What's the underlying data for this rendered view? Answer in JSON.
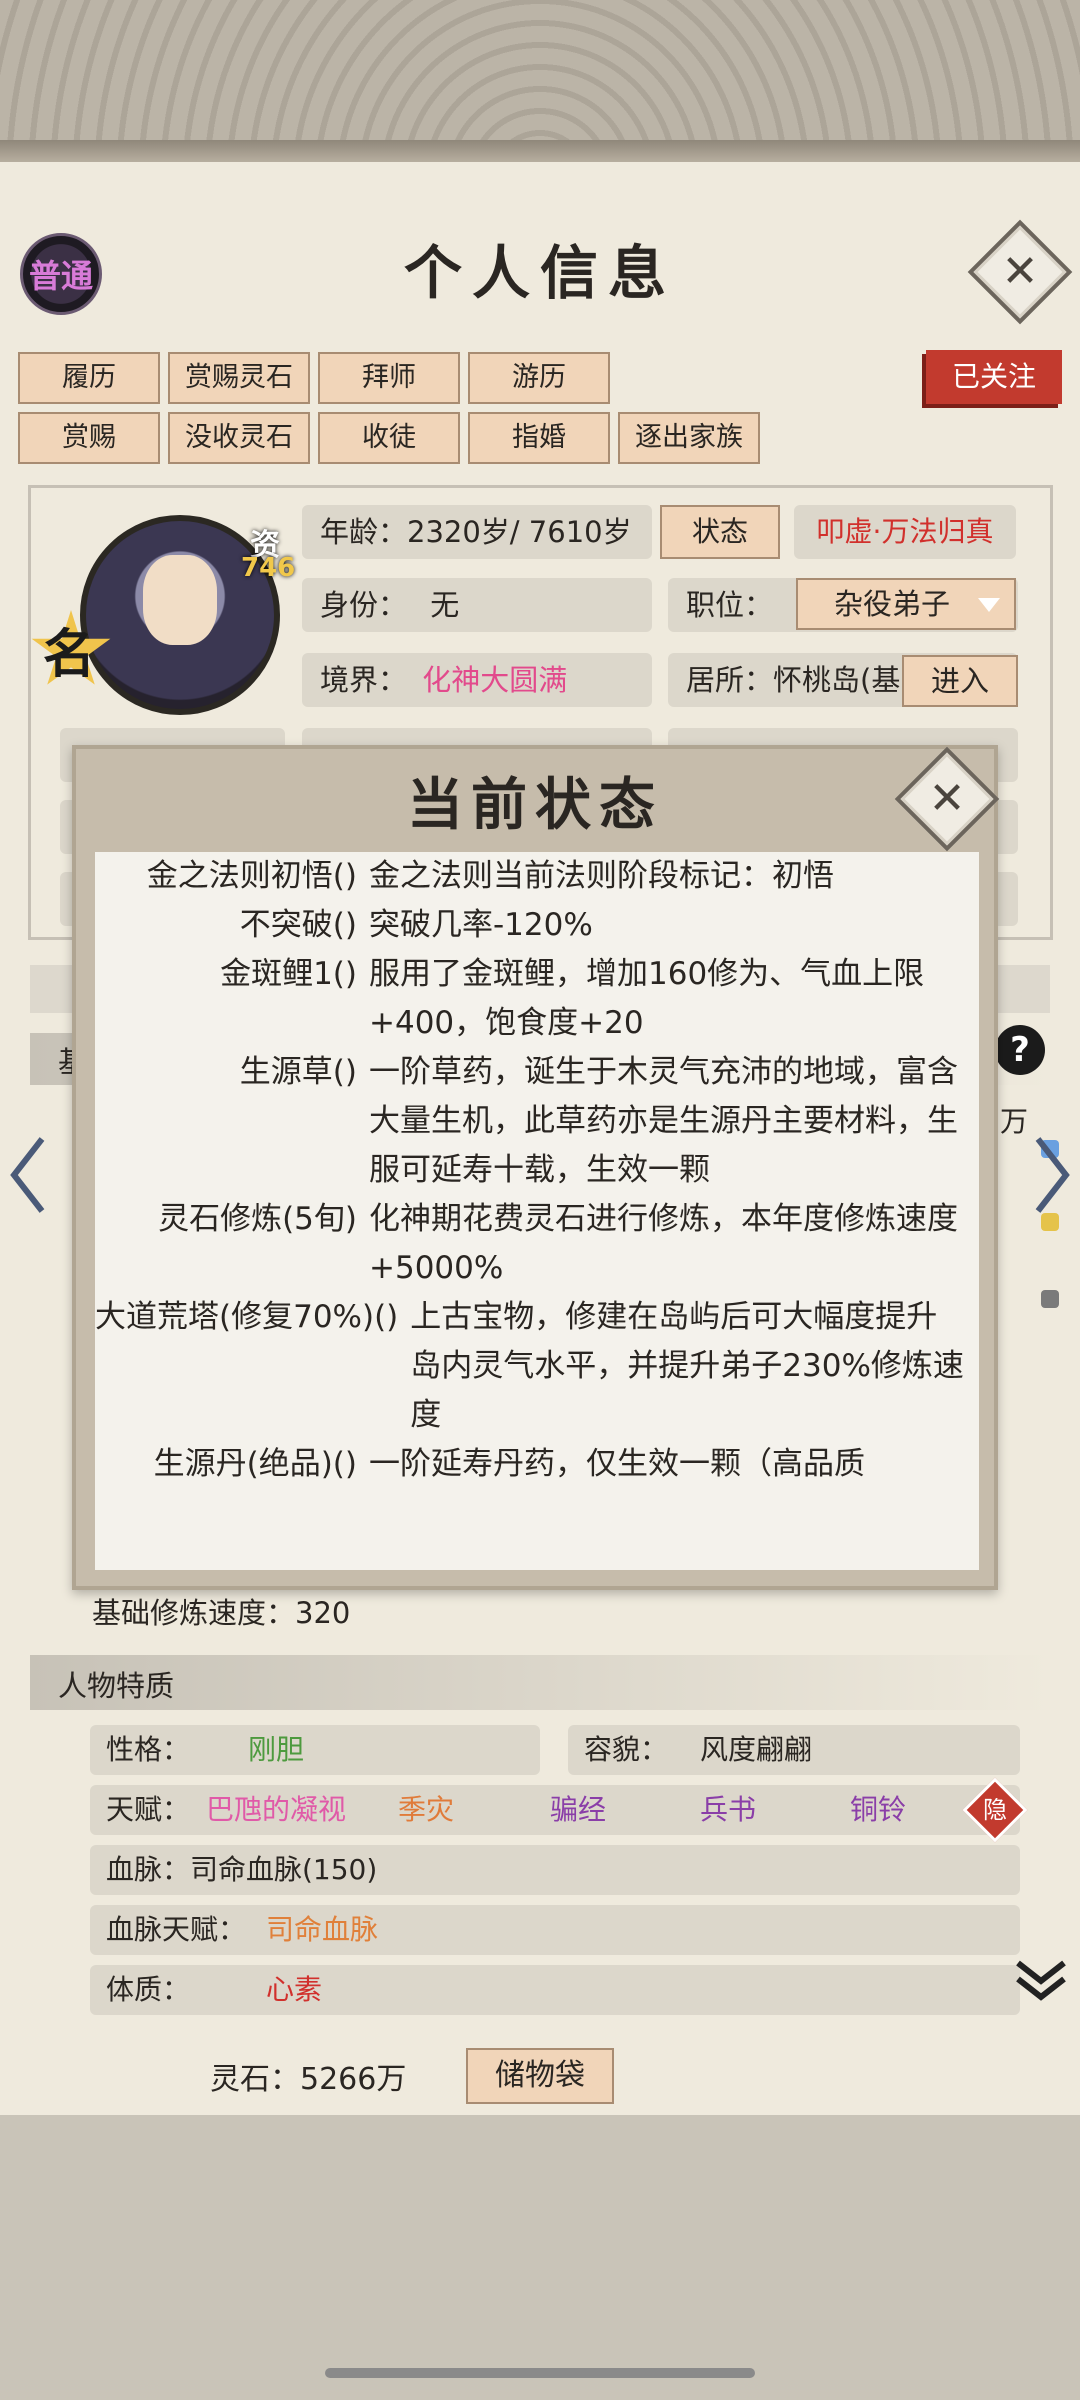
{
  "header": {
    "rank_badge": "普通",
    "title": "个人信息",
    "close_icon": "close-icon"
  },
  "actions": {
    "row1": [
      "履历",
      "赏赐灵石",
      "拜师",
      "游历"
    ],
    "row2": [
      "赏赐",
      "没收灵石",
      "收徒",
      "指婚",
      "逐出家族"
    ],
    "follow": "已关注"
  },
  "profile": {
    "aptitude_label": "资",
    "aptitude_value": "746",
    "fame_badge": "名",
    "age": "年龄：2320岁/ 7610岁",
    "status_button": "状态",
    "realm_title": "叩虚·万法归真",
    "identity_label": "身份：",
    "identity_value": "无",
    "position_label": "职位：",
    "position_value": "杂役弟子",
    "realm_label": "境界：",
    "realm_value": "化神大圆满",
    "residence": "居所：怀桃岛(基",
    "enter_button": "进入"
  },
  "behind": {
    "section_basic": "基",
    "wan": "万"
  },
  "modal": {
    "title": "当前状态",
    "items": [
      {
        "name": "金之法则初悟()",
        "desc": "金之法则当前法则阶段标记：初悟"
      },
      {
        "name": "不突破()",
        "desc": "突破几率-120%"
      },
      {
        "name": "金斑鲤1()",
        "desc": "服用了金斑鲤，增加160修为、气血上限+400，饱食度+20"
      },
      {
        "name": "生源草()",
        "desc": "一阶草药，诞生于木灵气充沛的地域，富含大量生机，此草药亦是生源丹主要材料，生服可延寿十载，生效一颗"
      },
      {
        "name": "灵石修炼(5旬)",
        "desc": "化神期花费灵石进行修炼，本年度修炼速度+5000%"
      },
      {
        "name": "大道荒塔(修复70%)()",
        "desc": "上古宝物，修建在岛屿后可大幅度提升岛内灵气水平，并提升弟子230%修炼速度"
      },
      {
        "name": "生源丹(绝品)()",
        "desc": "一阶延寿丹药，仅生效一颗（高品质"
      }
    ]
  },
  "base_speed": "基础修炼速度：320",
  "traits": {
    "section_title": "人物特质",
    "personality_label": "性格：",
    "personality_value": "刚胆",
    "appearance_label": "容貌：",
    "appearance_value": "风度翩翩",
    "talent_label": "天赋：",
    "talents": [
      "巴虺的凝视",
      "季灾",
      "骗经",
      "兵书",
      "铜铃"
    ],
    "hidden_badge": "隐",
    "bloodline": "血脉：司命血脉(150)",
    "bloodline_talent_label": "血脉天赋：",
    "bloodline_talent_value": "司命血脉",
    "constitution_label": "体质：",
    "constitution_value": "心素"
  },
  "footer": {
    "spirit_stones": "灵石：5266万",
    "bag_button": "储物袋"
  },
  "colors": {
    "accent_red": "#c23a2e",
    "pink": "#e24a8c",
    "button_fill": "#f1d5b9"
  }
}
